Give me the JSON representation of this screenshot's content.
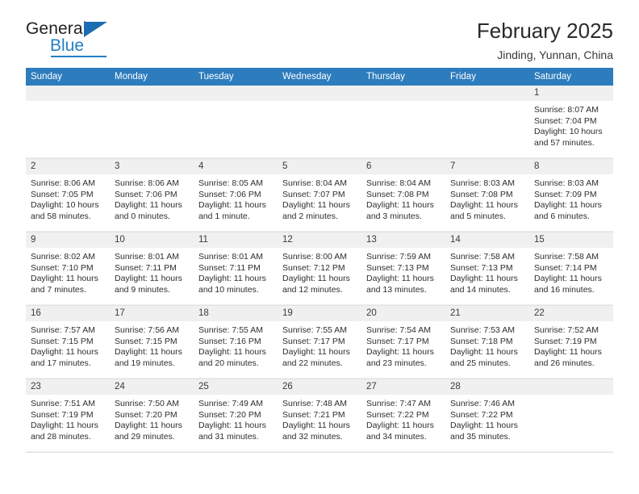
{
  "brand": {
    "name_part1": "General",
    "name_part2": "Blue",
    "accent_color": "#2380c5",
    "triangle_color": "#1b6cb0"
  },
  "header": {
    "title": "February 2025",
    "subtitle": "Jinding, Yunnan, China",
    "header_bg": "#2d7cbd"
  },
  "weekdays": [
    "Sunday",
    "Monday",
    "Tuesday",
    "Wednesday",
    "Thursday",
    "Friday",
    "Saturday"
  ],
  "weeks": [
    [
      {
        "day": "",
        "sunrise": "",
        "sunset": "",
        "daylight1": "",
        "daylight2": "",
        "empty": true
      },
      {
        "day": "",
        "sunrise": "",
        "sunset": "",
        "daylight1": "",
        "daylight2": "",
        "empty": true
      },
      {
        "day": "",
        "sunrise": "",
        "sunset": "",
        "daylight1": "",
        "daylight2": "",
        "empty": true
      },
      {
        "day": "",
        "sunrise": "",
        "sunset": "",
        "daylight1": "",
        "daylight2": "",
        "empty": true
      },
      {
        "day": "",
        "sunrise": "",
        "sunset": "",
        "daylight1": "",
        "daylight2": "",
        "empty": true
      },
      {
        "day": "",
        "sunrise": "",
        "sunset": "",
        "daylight1": "",
        "daylight2": "",
        "empty": true
      },
      {
        "day": "1",
        "sunrise": "Sunrise: 8:07 AM",
        "sunset": "Sunset: 7:04 PM",
        "daylight1": "Daylight: 10 hours",
        "daylight2": "and 57 minutes.",
        "empty": false
      }
    ],
    [
      {
        "day": "2",
        "sunrise": "Sunrise: 8:06 AM",
        "sunset": "Sunset: 7:05 PM",
        "daylight1": "Daylight: 10 hours",
        "daylight2": "and 58 minutes.",
        "empty": false
      },
      {
        "day": "3",
        "sunrise": "Sunrise: 8:06 AM",
        "sunset": "Sunset: 7:06 PM",
        "daylight1": "Daylight: 11 hours",
        "daylight2": "and 0 minutes.",
        "empty": false
      },
      {
        "day": "4",
        "sunrise": "Sunrise: 8:05 AM",
        "sunset": "Sunset: 7:06 PM",
        "daylight1": "Daylight: 11 hours",
        "daylight2": "and 1 minute.",
        "empty": false
      },
      {
        "day": "5",
        "sunrise": "Sunrise: 8:04 AM",
        "sunset": "Sunset: 7:07 PM",
        "daylight1": "Daylight: 11 hours",
        "daylight2": "and 2 minutes.",
        "empty": false
      },
      {
        "day": "6",
        "sunrise": "Sunrise: 8:04 AM",
        "sunset": "Sunset: 7:08 PM",
        "daylight1": "Daylight: 11 hours",
        "daylight2": "and 3 minutes.",
        "empty": false
      },
      {
        "day": "7",
        "sunrise": "Sunrise: 8:03 AM",
        "sunset": "Sunset: 7:08 PM",
        "daylight1": "Daylight: 11 hours",
        "daylight2": "and 5 minutes.",
        "empty": false
      },
      {
        "day": "8",
        "sunrise": "Sunrise: 8:03 AM",
        "sunset": "Sunset: 7:09 PM",
        "daylight1": "Daylight: 11 hours",
        "daylight2": "and 6 minutes.",
        "empty": false
      }
    ],
    [
      {
        "day": "9",
        "sunrise": "Sunrise: 8:02 AM",
        "sunset": "Sunset: 7:10 PM",
        "daylight1": "Daylight: 11 hours",
        "daylight2": "and 7 minutes.",
        "empty": false
      },
      {
        "day": "10",
        "sunrise": "Sunrise: 8:01 AM",
        "sunset": "Sunset: 7:11 PM",
        "daylight1": "Daylight: 11 hours",
        "daylight2": "and 9 minutes.",
        "empty": false
      },
      {
        "day": "11",
        "sunrise": "Sunrise: 8:01 AM",
        "sunset": "Sunset: 7:11 PM",
        "daylight1": "Daylight: 11 hours",
        "daylight2": "and 10 minutes.",
        "empty": false
      },
      {
        "day": "12",
        "sunrise": "Sunrise: 8:00 AM",
        "sunset": "Sunset: 7:12 PM",
        "daylight1": "Daylight: 11 hours",
        "daylight2": "and 12 minutes.",
        "empty": false
      },
      {
        "day": "13",
        "sunrise": "Sunrise: 7:59 AM",
        "sunset": "Sunset: 7:13 PM",
        "daylight1": "Daylight: 11 hours",
        "daylight2": "and 13 minutes.",
        "empty": false
      },
      {
        "day": "14",
        "sunrise": "Sunrise: 7:58 AM",
        "sunset": "Sunset: 7:13 PM",
        "daylight1": "Daylight: 11 hours",
        "daylight2": "and 14 minutes.",
        "empty": false
      },
      {
        "day": "15",
        "sunrise": "Sunrise: 7:58 AM",
        "sunset": "Sunset: 7:14 PM",
        "daylight1": "Daylight: 11 hours",
        "daylight2": "and 16 minutes.",
        "empty": false
      }
    ],
    [
      {
        "day": "16",
        "sunrise": "Sunrise: 7:57 AM",
        "sunset": "Sunset: 7:15 PM",
        "daylight1": "Daylight: 11 hours",
        "daylight2": "and 17 minutes.",
        "empty": false
      },
      {
        "day": "17",
        "sunrise": "Sunrise: 7:56 AM",
        "sunset": "Sunset: 7:15 PM",
        "daylight1": "Daylight: 11 hours",
        "daylight2": "and 19 minutes.",
        "empty": false
      },
      {
        "day": "18",
        "sunrise": "Sunrise: 7:55 AM",
        "sunset": "Sunset: 7:16 PM",
        "daylight1": "Daylight: 11 hours",
        "daylight2": "and 20 minutes.",
        "empty": false
      },
      {
        "day": "19",
        "sunrise": "Sunrise: 7:55 AM",
        "sunset": "Sunset: 7:17 PM",
        "daylight1": "Daylight: 11 hours",
        "daylight2": "and 22 minutes.",
        "empty": false
      },
      {
        "day": "20",
        "sunrise": "Sunrise: 7:54 AM",
        "sunset": "Sunset: 7:17 PM",
        "daylight1": "Daylight: 11 hours",
        "daylight2": "and 23 minutes.",
        "empty": false
      },
      {
        "day": "21",
        "sunrise": "Sunrise: 7:53 AM",
        "sunset": "Sunset: 7:18 PM",
        "daylight1": "Daylight: 11 hours",
        "daylight2": "and 25 minutes.",
        "empty": false
      },
      {
        "day": "22",
        "sunrise": "Sunrise: 7:52 AM",
        "sunset": "Sunset: 7:19 PM",
        "daylight1": "Daylight: 11 hours",
        "daylight2": "and 26 minutes.",
        "empty": false
      }
    ],
    [
      {
        "day": "23",
        "sunrise": "Sunrise: 7:51 AM",
        "sunset": "Sunset: 7:19 PM",
        "daylight1": "Daylight: 11 hours",
        "daylight2": "and 28 minutes.",
        "empty": false
      },
      {
        "day": "24",
        "sunrise": "Sunrise: 7:50 AM",
        "sunset": "Sunset: 7:20 PM",
        "daylight1": "Daylight: 11 hours",
        "daylight2": "and 29 minutes.",
        "empty": false
      },
      {
        "day": "25",
        "sunrise": "Sunrise: 7:49 AM",
        "sunset": "Sunset: 7:20 PM",
        "daylight1": "Daylight: 11 hours",
        "daylight2": "and 31 minutes.",
        "empty": false
      },
      {
        "day": "26",
        "sunrise": "Sunrise: 7:48 AM",
        "sunset": "Sunset: 7:21 PM",
        "daylight1": "Daylight: 11 hours",
        "daylight2": "and 32 minutes.",
        "empty": false
      },
      {
        "day": "27",
        "sunrise": "Sunrise: 7:47 AM",
        "sunset": "Sunset: 7:22 PM",
        "daylight1": "Daylight: 11 hours",
        "daylight2": "and 34 minutes.",
        "empty": false
      },
      {
        "day": "28",
        "sunrise": "Sunrise: 7:46 AM",
        "sunset": "Sunset: 7:22 PM",
        "daylight1": "Daylight: 11 hours",
        "daylight2": "and 35 minutes.",
        "empty": false
      },
      {
        "day": "",
        "sunrise": "",
        "sunset": "",
        "daylight1": "",
        "daylight2": "",
        "empty": true
      }
    ]
  ]
}
